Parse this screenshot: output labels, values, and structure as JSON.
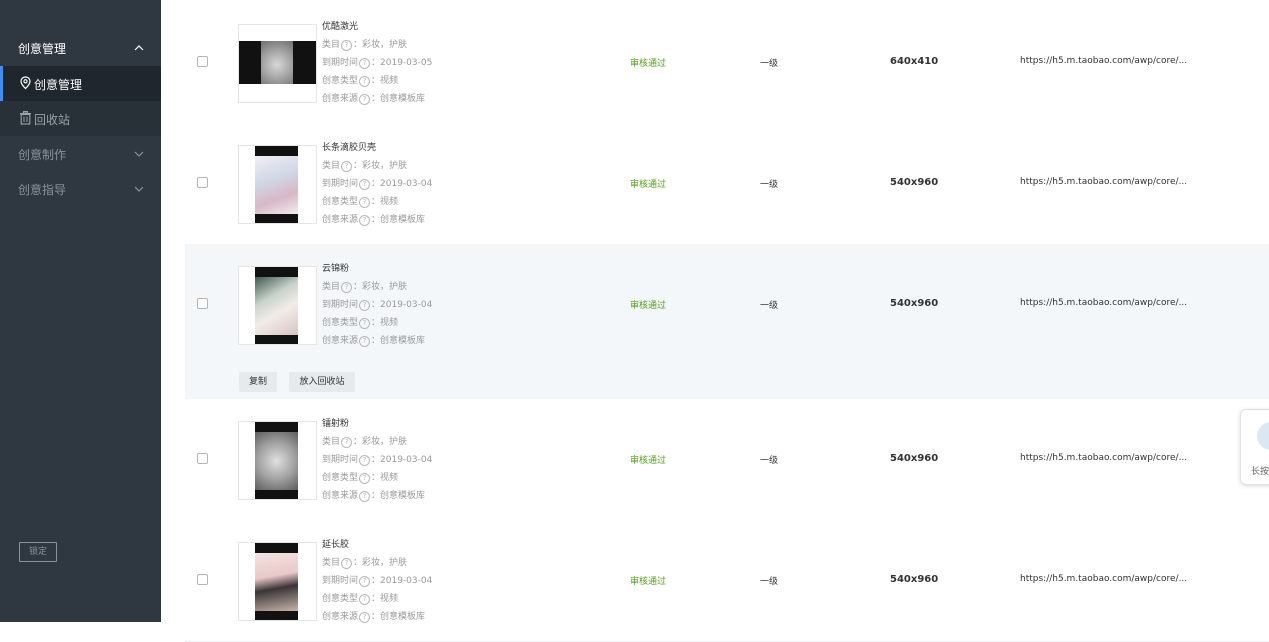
{
  "sidebar": {
    "groups": [
      {
        "label": "创意管理",
        "expanded": true
      },
      {
        "label": "创意制作",
        "expanded": false
      },
      {
        "label": "创意指导",
        "expanded": false
      }
    ],
    "sub_items": [
      {
        "label": "创意管理",
        "icon": "location-pin-icon",
        "active": true
      },
      {
        "label": "回收站",
        "icon": "trash-icon",
        "active": false
      }
    ],
    "lock_label": "锁定"
  },
  "field_labels": {
    "category": "类目",
    "expire": "到期时间",
    "type": "创意类型",
    "source": "创意来源",
    "help_icon": "?"
  },
  "rows": [
    {
      "title": "优酷激光",
      "category": "：彩妆，护肤",
      "expire": "：2019-03-05",
      "type": "：视频",
      "source": "：创意模板库",
      "status": "审核通过",
      "level": "一级",
      "size": "640x410",
      "url": "https://h5.m.taobao.com/awp/core/..."
    },
    {
      "title": "长条滴胶贝壳",
      "category": "：彩妆，护肤",
      "expire": "：2019-03-04",
      "type": "：视频",
      "source": "：创意模板库",
      "status": "审核通过",
      "level": "一级",
      "size": "540x960",
      "url": "https://h5.m.taobao.com/awp/core/..."
    },
    {
      "title": "云锦粉",
      "category": "：彩妆，护肤",
      "expire": "：2019-03-04",
      "type": "：视频",
      "source": "：创意模板库",
      "status": "审核通过",
      "level": "一级",
      "size": "540x960",
      "url": "https://h5.m.taobao.com/awp/core/..."
    },
    {
      "title": "镭射粉",
      "category": "：彩妆，护肤",
      "expire": "：2019-03-04",
      "type": "：视频",
      "source": "：创意模板库",
      "status": "审核通过",
      "level": "一级",
      "size": "540x960",
      "url": "https://h5.m.taobao.com/awp/core/..."
    },
    {
      "title": "延长胶",
      "category": "：彩妆，护肤",
      "expire": "：2019-03-04",
      "type": "：视频",
      "source": "：创意模板库",
      "status": "审核通过",
      "level": "一级",
      "size": "540x960",
      "url": "https://h5.m.taobao.com/awp/core/..."
    }
  ],
  "row_actions": {
    "copy": "复制",
    "recycle": "放入回收站"
  },
  "floating_widget": {
    "label": "长按"
  },
  "colors": {
    "sidebar_bg": "#2f3740",
    "accent": "#3d8ef7",
    "status_green": "#53a316",
    "row_highlight": "#f4f7fa"
  }
}
